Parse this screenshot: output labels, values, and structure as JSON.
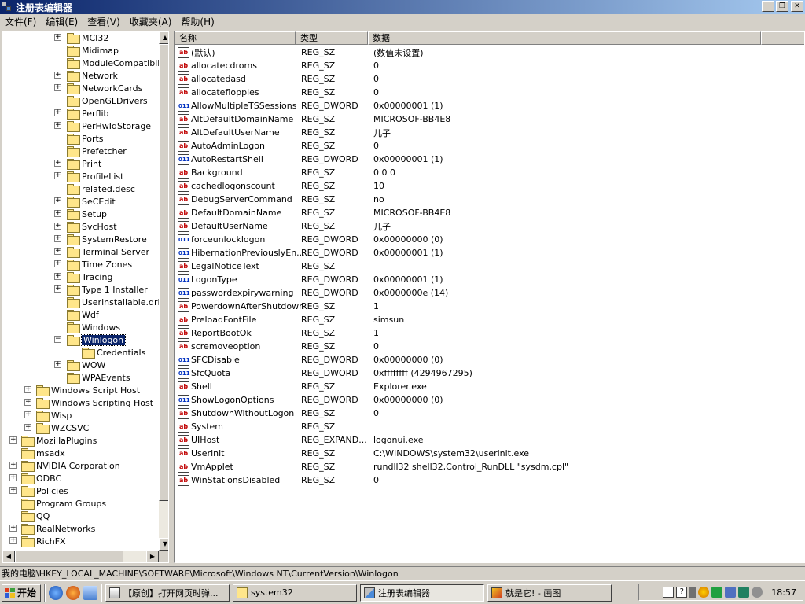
{
  "window": {
    "title": "注册表编辑器"
  },
  "menu": [
    "文件(F)",
    "编辑(E)",
    "查看(V)",
    "收藏夹(A)",
    "帮助(H)"
  ],
  "tree": [
    {
      "label": "MCI32",
      "level": 3,
      "exp": "+"
    },
    {
      "label": "Midimap",
      "level": 3,
      "exp": ""
    },
    {
      "label": "ModuleCompatibility",
      "level": 3,
      "exp": ""
    },
    {
      "label": "Network",
      "level": 3,
      "exp": "+"
    },
    {
      "label": "NetworkCards",
      "level": 3,
      "exp": "+"
    },
    {
      "label": "OpenGLDrivers",
      "level": 3,
      "exp": ""
    },
    {
      "label": "Perflib",
      "level": 3,
      "exp": "+"
    },
    {
      "label": "PerHwIdStorage",
      "level": 3,
      "exp": "+"
    },
    {
      "label": "Ports",
      "level": 3,
      "exp": ""
    },
    {
      "label": "Prefetcher",
      "level": 3,
      "exp": ""
    },
    {
      "label": "Print",
      "level": 3,
      "exp": "+"
    },
    {
      "label": "ProfileList",
      "level": 3,
      "exp": "+"
    },
    {
      "label": "related.desc",
      "level": 3,
      "exp": ""
    },
    {
      "label": "SeCEdit",
      "level": 3,
      "exp": "+"
    },
    {
      "label": "Setup",
      "level": 3,
      "exp": "+"
    },
    {
      "label": "SvcHost",
      "level": 3,
      "exp": "+"
    },
    {
      "label": "SystemRestore",
      "level": 3,
      "exp": "+"
    },
    {
      "label": "Terminal Server",
      "level": 3,
      "exp": "+"
    },
    {
      "label": "Time Zones",
      "level": 3,
      "exp": "+"
    },
    {
      "label": "Tracing",
      "level": 3,
      "exp": "+"
    },
    {
      "label": "Type 1 Installer",
      "level": 3,
      "exp": "+"
    },
    {
      "label": "Userinstallable.drivers",
      "level": 3,
      "exp": ""
    },
    {
      "label": "Wdf",
      "level": 3,
      "exp": ""
    },
    {
      "label": "Windows",
      "level": 3,
      "exp": ""
    },
    {
      "label": "Winlogon",
      "level": 3,
      "exp": "−",
      "selected": true
    },
    {
      "label": "Credentials",
      "level": 4,
      "exp": ""
    },
    {
      "label": "WOW",
      "level": 3,
      "exp": "+"
    },
    {
      "label": "WPAEvents",
      "level": 3,
      "exp": ""
    },
    {
      "label": "Windows Script Host",
      "level": 1,
      "exp": "+"
    },
    {
      "label": "Windows Scripting Host",
      "level": 1,
      "exp": "+"
    },
    {
      "label": "Wisp",
      "level": 1,
      "exp": "+"
    },
    {
      "label": "WZCSVC",
      "level": 1,
      "exp": "+"
    },
    {
      "label": "MozillaPlugins",
      "level": 0,
      "exp": "+"
    },
    {
      "label": "msadx",
      "level": 0,
      "exp": ""
    },
    {
      "label": "NVIDIA Corporation",
      "level": 0,
      "exp": "+"
    },
    {
      "label": "ODBC",
      "level": 0,
      "exp": "+"
    },
    {
      "label": "Policies",
      "level": 0,
      "exp": "+"
    },
    {
      "label": "Program Groups",
      "level": 0,
      "exp": ""
    },
    {
      "label": "QQ",
      "level": 0,
      "exp": ""
    },
    {
      "label": "RealNetworks",
      "level": 0,
      "exp": "+"
    },
    {
      "label": "RichFX",
      "level": 0,
      "exp": "+"
    }
  ],
  "columns": [
    "名称",
    "类型",
    "数据"
  ],
  "values": [
    {
      "name": "(默认)",
      "type": "REG_SZ",
      "data": "(数值未设置)"
    },
    {
      "name": "allocatecdroms",
      "type": "REG_SZ",
      "data": "0"
    },
    {
      "name": "allocatedasd",
      "type": "REG_SZ",
      "data": "0"
    },
    {
      "name": "allocatefloppies",
      "type": "REG_SZ",
      "data": "0"
    },
    {
      "name": "AllowMultipleTSSessions",
      "type": "REG_DWORD",
      "data": "0x00000001 (1)"
    },
    {
      "name": "AltDefaultDomainName",
      "type": "REG_SZ",
      "data": "MICROSOF-BB4E8"
    },
    {
      "name": "AltDefaultUserName",
      "type": "REG_SZ",
      "data": "儿子"
    },
    {
      "name": "AutoAdminLogon",
      "type": "REG_SZ",
      "data": "0"
    },
    {
      "name": "AutoRestartShell",
      "type": "REG_DWORD",
      "data": "0x00000001 (1)"
    },
    {
      "name": "Background",
      "type": "REG_SZ",
      "data": "0 0 0"
    },
    {
      "name": "cachedlogonscount",
      "type": "REG_SZ",
      "data": "10"
    },
    {
      "name": "DebugServerCommand",
      "type": "REG_SZ",
      "data": "no"
    },
    {
      "name": "DefaultDomainName",
      "type": "REG_SZ",
      "data": "MICROSOF-BB4E8"
    },
    {
      "name": "DefaultUserName",
      "type": "REG_SZ",
      "data": "儿子"
    },
    {
      "name": "forceunlocklogon",
      "type": "REG_DWORD",
      "data": "0x00000000 (0)"
    },
    {
      "name": "HibernationPreviouslyEn...",
      "type": "REG_DWORD",
      "data": "0x00000001 (1)"
    },
    {
      "name": "LegalNoticeText",
      "type": "REG_SZ",
      "data": ""
    },
    {
      "name": "LogonType",
      "type": "REG_DWORD",
      "data": "0x00000001 (1)"
    },
    {
      "name": "passwordexpirywarning",
      "type": "REG_DWORD",
      "data": "0x0000000e (14)"
    },
    {
      "name": "PowerdownAfterShutdown",
      "type": "REG_SZ",
      "data": "1"
    },
    {
      "name": "PreloadFontFile",
      "type": "REG_SZ",
      "data": "simsun"
    },
    {
      "name": "ReportBootOk",
      "type": "REG_SZ",
      "data": "1"
    },
    {
      "name": "scremoveoption",
      "type": "REG_SZ",
      "data": "0"
    },
    {
      "name": "SFCDisable",
      "type": "REG_DWORD",
      "data": "0x00000000 (0)"
    },
    {
      "name": "SfcQuota",
      "type": "REG_DWORD",
      "data": "0xffffffff (4294967295)"
    },
    {
      "name": "Shell",
      "type": "REG_SZ",
      "data": "Explorer.exe"
    },
    {
      "name": "ShowLogonOptions",
      "type": "REG_DWORD",
      "data": "0x00000000 (0)"
    },
    {
      "name": "ShutdownWithoutLogon",
      "type": "REG_SZ",
      "data": "0"
    },
    {
      "name": "System",
      "type": "REG_SZ",
      "data": ""
    },
    {
      "name": "UIHost",
      "type": "REG_EXPAND...",
      "data": "logonui.exe"
    },
    {
      "name": "Userinit",
      "type": "REG_SZ",
      "data": "C:\\WINDOWS\\system32\\userinit.exe"
    },
    {
      "name": "VmApplet",
      "type": "REG_SZ",
      "data": "rundll32 shell32,Control_RunDLL \"sysdm.cpl\""
    },
    {
      "name": "WinStationsDisabled",
      "type": "REG_SZ",
      "data": "0"
    }
  ],
  "status": "我的电脑\\HKEY_LOCAL_MACHINE\\SOFTWARE\\Microsoft\\Windows NT\\CurrentVersion\\Winlogon",
  "taskbar": {
    "start": "开始",
    "tasks": [
      "【原创】打开网页时弹...",
      "system32",
      "注册表编辑器",
      "就是它! - 画图"
    ],
    "clock": "18:57"
  }
}
